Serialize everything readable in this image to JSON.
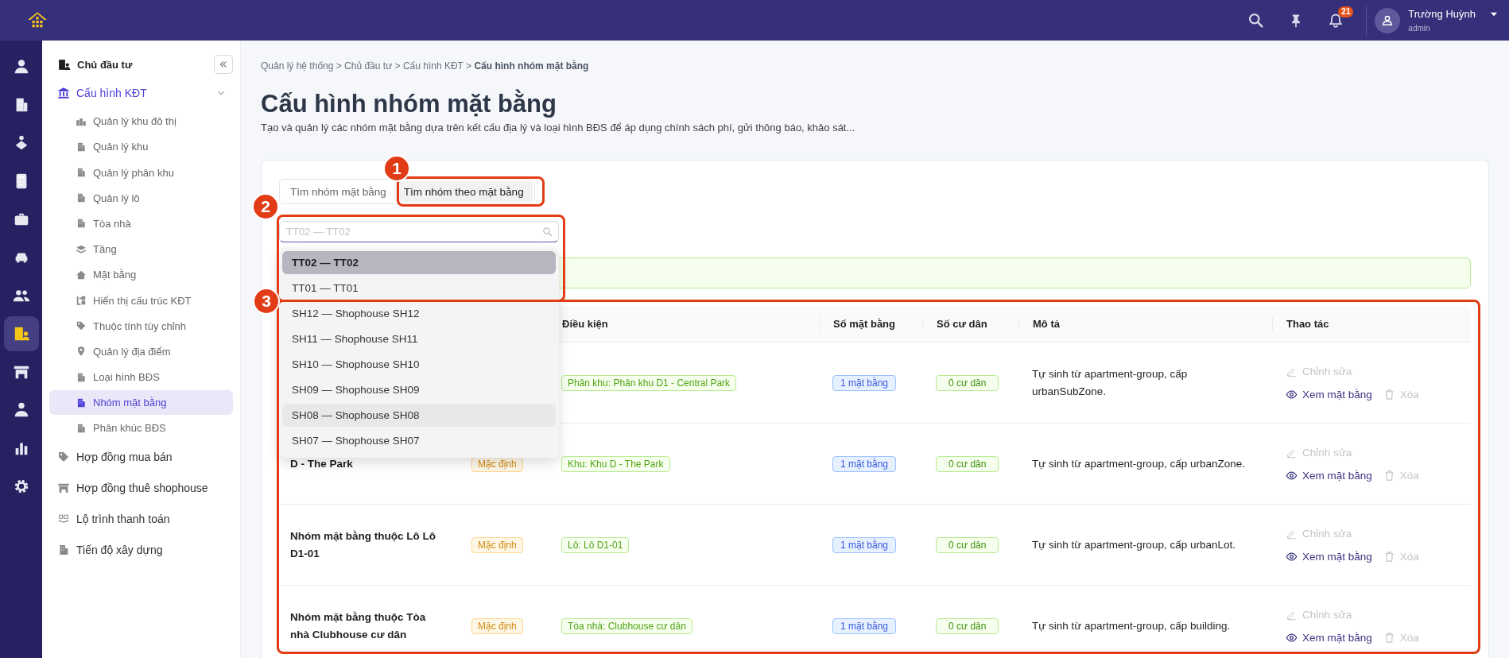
{
  "top_bar": {
    "notification_count": "21",
    "user": {
      "name": "Trường Huỳnh",
      "role": "admin"
    }
  },
  "rail_items": [
    {
      "selected": false
    },
    {
      "selected": false
    },
    {
      "selected": false
    },
    {
      "selected": false
    },
    {
      "selected": false
    },
    {
      "selected": false
    },
    {
      "selected": false
    },
    {
      "selected": true
    },
    {
      "selected": false
    },
    {
      "selected": false
    },
    {
      "selected": false
    },
    {
      "selected": false
    }
  ],
  "sidebar": {
    "title": "Chủ đầu tư",
    "items": [
      {
        "label": "Cấu hình KĐT",
        "expanded": true,
        "children": [
          {
            "label": "Quản lý khu đô thị",
            "selected": false
          },
          {
            "label": "Quản lý khu",
            "selected": false
          },
          {
            "label": "Quản lý phân khu",
            "selected": false
          },
          {
            "label": "Quản lý lô",
            "selected": false
          },
          {
            "label": "Tòa nhà",
            "selected": false
          },
          {
            "label": "Tầng",
            "selected": false
          },
          {
            "label": "Mặt bằng",
            "selected": false
          },
          {
            "label": "Hiển thị cấu trúc KĐT",
            "selected": false
          },
          {
            "label": "Thuộc tính tùy chỉnh",
            "selected": false
          },
          {
            "label": "Quản lý địa điểm",
            "selected": false
          },
          {
            "label": "Loại hình BĐS",
            "selected": false
          },
          {
            "label": "Nhóm mặt bằng",
            "selected": true
          },
          {
            "label": "Phân khúc BĐS",
            "selected": false
          }
        ]
      },
      {
        "label": "Hợp đồng mua bán",
        "expanded": false
      },
      {
        "label": "Hợp đồng thuê shophouse",
        "expanded": false
      },
      {
        "label": "Lộ trình thanh toán",
        "expanded": false
      },
      {
        "label": "Tiến độ xây dựng",
        "expanded": false
      }
    ]
  },
  "breadcrumb": {
    "separator": ">",
    "items": [
      {
        "label": "Quản lý hệ thống",
        "current": false
      },
      {
        "label": "Chủ đầu tư",
        "current": false
      },
      {
        "label": "Cấu hình KĐT",
        "current": false
      },
      {
        "label": "Cấu hình nhóm mặt bằng",
        "current": true
      }
    ]
  },
  "page": {
    "title": "Cấu hình nhóm mặt bằng",
    "subtitle": "Tạo và quản lý các nhóm mặt bằng dựa trên kết cấu địa lý và loại hình BĐS để áp dụng chính sách phí, gửi thông báo, khảo sát..."
  },
  "tabs": [
    {
      "label": "Tìm nhóm mặt bằng",
      "selected": false
    },
    {
      "label": "Tìm nhóm theo mặt bằng",
      "selected": true
    }
  ],
  "search": {
    "placeholder": "TT02 — TT02"
  },
  "dropdown": {
    "options": [
      {
        "label": "TT02 — TT02",
        "selected": true,
        "highlighted": false
      },
      {
        "label": "TT01 — TT01",
        "selected": false,
        "highlighted": false
      },
      {
        "label": "SH12 — Shophouse SH12",
        "selected": false,
        "highlighted": false
      },
      {
        "label": "SH11 — Shophouse SH11",
        "selected": false,
        "highlighted": false
      },
      {
        "label": "SH10 — Shophouse SH10",
        "selected": false,
        "highlighted": false
      },
      {
        "label": "SH09 — Shophouse SH09",
        "selected": false,
        "highlighted": false
      },
      {
        "label": "SH08 — Shophouse SH08",
        "selected": false,
        "highlighted": true
      },
      {
        "label": "SH07 — Shophouse SH07",
        "selected": false,
        "highlighted": false
      }
    ]
  },
  "table": {
    "columns": [
      {
        "label": "Điều kiện"
      },
      {
        "label": "Số mặt bằng"
      },
      {
        "label": "Số cư dân"
      },
      {
        "label": "Mô tả"
      },
      {
        "label": "Thao tác"
      }
    ],
    "rows": [
      {
        "condition": "Phân khu: Phân khu D1 - Central Park",
        "apartments": "1 mặt bằng",
        "residents": "0 cư dân",
        "description": "Tự sinh từ apartment-group, cấp urbanSubZone.",
        "actions": [
          {
            "label": "Chỉnh sửa",
            "disabled": true
          },
          {
            "label": "Xem mặt bằng",
            "disabled": false
          },
          {
            "label": "Xóa",
            "disabled": true
          }
        ]
      },
      {
        "name": "D - The Park",
        "type": "Mặc định",
        "condition": "Khu: Khu D - The Park",
        "apartments": "1 mặt bằng",
        "residents": "0 cư dân",
        "description": "Tự sinh từ apartment-group, cấp urbanZone.",
        "actions": [
          {
            "label": "Chỉnh sửa",
            "disabled": true
          },
          {
            "label": "Xem mặt bằng",
            "disabled": false
          },
          {
            "label": "Xóa",
            "disabled": true
          }
        ]
      },
      {
        "name": "Nhóm mặt bằng thuộc Lô Lô D1-01",
        "type": "Mặc định",
        "condition": "Lô: Lô D1-01",
        "apartments": "1 mặt bằng",
        "residents": "0 cư dân",
        "description": "Tự sinh từ apartment-group, cấp urbanLot.",
        "actions": [
          {
            "label": "Chỉnh sửa",
            "disabled": true
          },
          {
            "label": "Xem mặt bằng",
            "disabled": false
          },
          {
            "label": "Xóa",
            "disabled": true
          }
        ]
      },
      {
        "name": "Nhóm mặt bằng thuộc Tòa nhà Clubhouse cư dân",
        "type": "Mặc định",
        "condition": "Tòa nhà: Clubhouse cư dân",
        "apartments": "1 mặt bằng",
        "residents": "0 cư dân",
        "description": "Tự sinh từ apartment-group, cấp building.",
        "actions": [
          {
            "label": "Chỉnh sửa",
            "disabled": true
          },
          {
            "label": "Xem mặt bằng",
            "disabled": false
          },
          {
            "label": "Xóa",
            "disabled": true
          }
        ]
      }
    ]
  },
  "annotations": [
    {
      "number": "1"
    },
    {
      "number": "2"
    },
    {
      "number": "3"
    }
  ]
}
